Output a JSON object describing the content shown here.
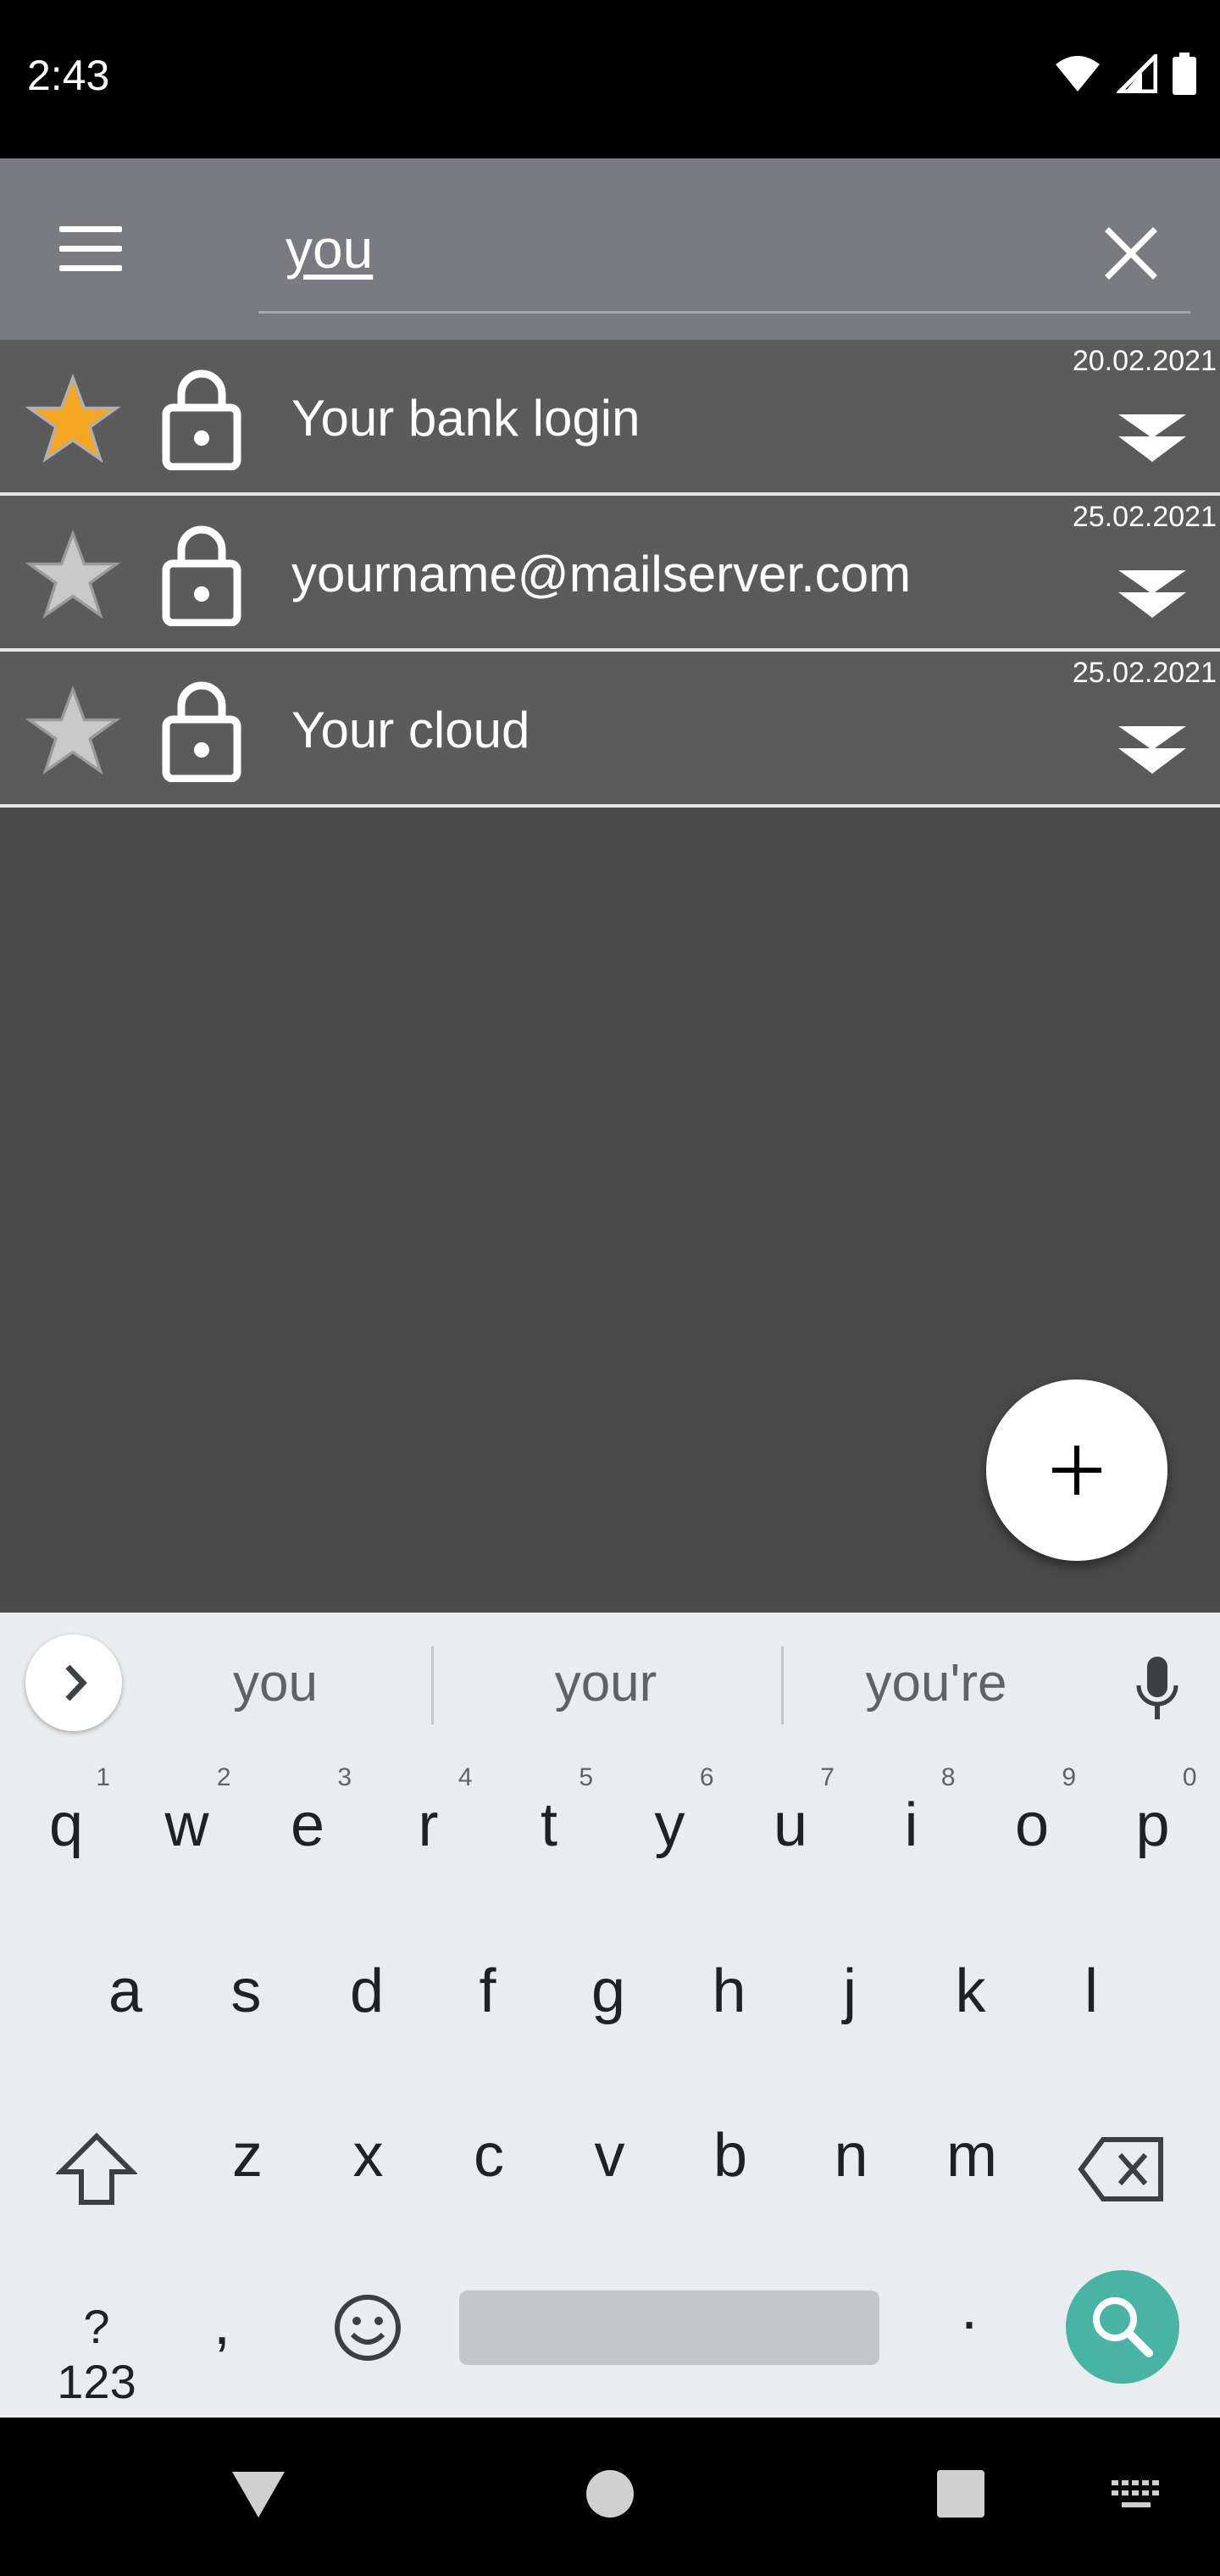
{
  "status_bar": {
    "time": "2:43"
  },
  "search": {
    "query": "you"
  },
  "entries": [
    {
      "title": "Your bank login",
      "date": "20.02.2021",
      "favorite": true
    },
    {
      "title": "yourname@mailserver.com",
      "date": "25.02.2021",
      "favorite": false
    },
    {
      "title": "Your cloud",
      "date": "25.02.2021",
      "favorite": false
    }
  ],
  "keyboard": {
    "suggestions": [
      "you",
      "your",
      "you're"
    ],
    "row1": [
      {
        "k": "q",
        "n": "1"
      },
      {
        "k": "w",
        "n": "2"
      },
      {
        "k": "e",
        "n": "3"
      },
      {
        "k": "r",
        "n": "4"
      },
      {
        "k": "t",
        "n": "5"
      },
      {
        "k": "y",
        "n": "6"
      },
      {
        "k": "u",
        "n": "7"
      },
      {
        "k": "i",
        "n": "8"
      },
      {
        "k": "o",
        "n": "9"
      },
      {
        "k": "p",
        "n": "0"
      }
    ],
    "row2": [
      "a",
      "s",
      "d",
      "f",
      "g",
      "h",
      "j",
      "k",
      "l"
    ],
    "row3": [
      "z",
      "x",
      "c",
      "v",
      "b",
      "n",
      "m"
    ],
    "symbols_label": "?123",
    "comma": ",",
    "period": "."
  },
  "colors": {
    "app_bar": "#7a7b80",
    "list_bg": "#4a4a4a",
    "row_bg": "#5b5b5b",
    "fab": "#ffffff",
    "keyboard_bg": "#e9edf0",
    "search_key": "#48b4a4",
    "star_on": "#f5a623"
  }
}
